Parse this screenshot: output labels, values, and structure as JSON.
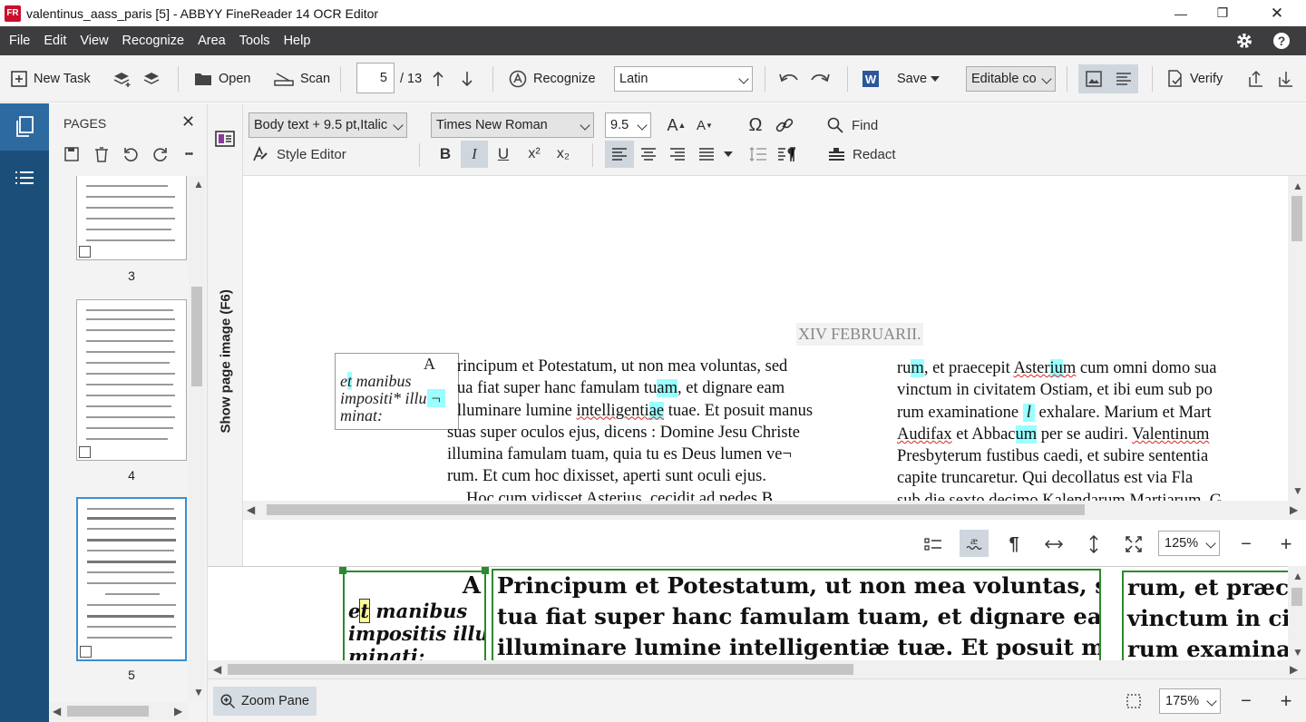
{
  "window": {
    "title": "valentinus_aass_paris [5] - ABBYY FineReader 14 OCR Editor",
    "app_icon": "FR",
    "minimize": "—",
    "maximize": "❐",
    "close": "✕"
  },
  "menu": [
    "File",
    "Edit",
    "View",
    "Recognize",
    "Area",
    "Tools",
    "Help"
  ],
  "toolbar": {
    "new_task": "New Task",
    "open": "Open",
    "scan": "Scan",
    "page_current": "5",
    "page_total": "/ 13",
    "recognize": "Recognize",
    "language": "Latin",
    "save": "Save",
    "save_format": "Editable co",
    "verify": "Verify"
  },
  "pages_panel": {
    "title": "PAGES",
    "close": "✕",
    "more": "•••",
    "pages": [
      {
        "num": "3"
      },
      {
        "num": "4"
      },
      {
        "num": "5",
        "selected": true
      }
    ]
  },
  "show_image": "Show page image (F6)",
  "format": {
    "style": "Body text + 9.5 pt,Italic",
    "font": "Times New Roman",
    "size": "9.5",
    "find": "Find",
    "style_editor": "Style Editor",
    "redact": "Redact",
    "bold": "B",
    "italic": "I",
    "underline": "U",
    "superscript": "x²",
    "subscript": "x₂",
    "grow": "A",
    "shrink": "A",
    "omega": "Ω"
  },
  "document": {
    "heading": "XIV FEBRUARII.",
    "margin_note": {
      "letter": "A",
      "l1_pre": "e",
      "l1_hl": "t",
      "l1_post": " manibus",
      "l2_pre": "impositi* illu",
      "l2_hl": "¬",
      "l3": "minat:"
    },
    "col1": {
      "l1": "rincipum et Potestatum, ut non mea voluntas, sed",
      "l2_pre": "ua fiat super hanc famulam tu",
      "l2_hl": "am",
      "l2_post": ", et dignare eam",
      "l3_pre": "lluminare lumine ",
      "l3_w": "intelligenti",
      "l3_hl": "ae",
      "l3_post": " tuae. Et posuit manus",
      "l4": "suas super oculos ejus, dicens : Domine Jesu Christe",
      "l5": "illumina famulam tuam, quia tu es Deus lumen ve¬",
      "l6": "rum. Et cum hoc dixisset, aperti sunt oculi ejus.",
      "l7": "Hoc cum vidisset Asterius, cecidit ad pedes B"
    },
    "col2": {
      "l1_pre": "ru",
      "l1_hl": "m",
      "l1_mid": ", et praecepit ",
      "l1_w1": "Aster",
      "l1_hl2": "iu",
      "l1_w2": "m",
      "l1_post": " cum omni domo sua",
      "l2": "vinctum in civitatem Ostiam, et ibi eum sub po",
      "l3_pre": "rum examinatione ",
      "l3_hl": "l",
      "l3_post": " exhalare. Marium et Mart",
      "l4_w": "Audifax",
      "l4_mid": " et Abbac",
      "l4_hl": "um",
      "l4_post": " per se audiri. ",
      "l4_w2": "Valentinum",
      "l5": "Presbyterum fustibus caedi, et subire sententia",
      "l6": "capite truncaretur. Qui decollatus est via Fla",
      "l7": "sub die sexto decimo Kalendarum Martiarum. G"
    }
  },
  "view": {
    "zoom": "125%"
  },
  "image_pane": {
    "b1": {
      "letter": "A",
      "l1_pre": "e",
      "l1_hl": "t",
      "l1_post": " manibus",
      "l2": "impositis illu-",
      "l3": "minati:"
    },
    "b2": {
      "l1": "Principum et Potestatum, ut non mea voluntas, sed",
      "l2": "tua fiat super hanc famulam tuam, et dignare eam",
      "l3": "illuminare lumine intelligentiæ tuæ. Et posuit manus"
    },
    "b3": {
      "l1": "rum, et præce",
      "l2": "vinctum in civ",
      "l3": "rum examinat"
    }
  },
  "bottom": {
    "zoom_pane": "Zoom Pane",
    "zoom": "175%"
  }
}
